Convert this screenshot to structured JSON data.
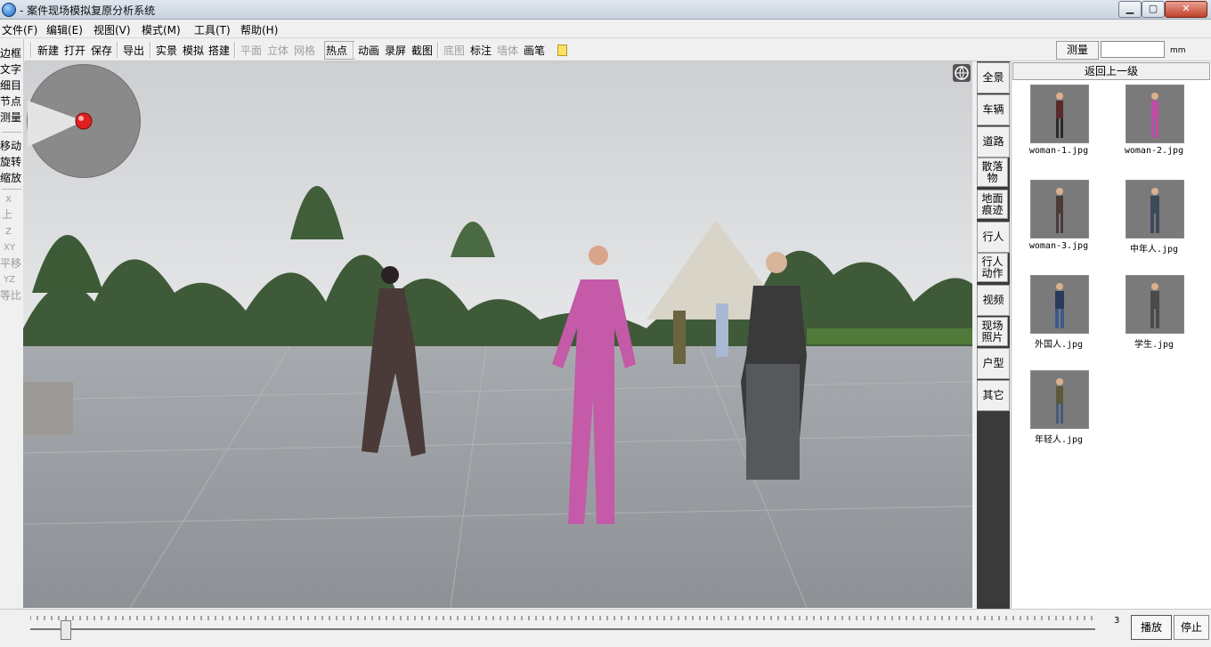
{
  "window": {
    "title": "- 案件现场模拟复原分析系统",
    "minimize": "▁",
    "maximize": "▢",
    "close": "✕"
  },
  "menu": [
    "文件(F)",
    "编辑(E)",
    "视图(V)",
    "模式(M)",
    "工具(T)",
    "帮助(H)"
  ],
  "toolbar": {
    "new": "新建",
    "open": "打开",
    "save": "保存",
    "export": "导出",
    "real": "实景",
    "simulate": "模拟",
    "build": "搭建",
    "plane": "平面",
    "solid": "立体",
    "grid": "网格",
    "hotspot": "热点",
    "animation": "动画",
    "record": "录屏",
    "screenshot": "截图",
    "basemap": "底图",
    "annotate": "标注",
    "wall": "墙体",
    "pen": "画笔",
    "measure": "测量",
    "measure_unit": "mm",
    "measure_value": ""
  },
  "left_tools": [
    "边框",
    "文字",
    "细目",
    "节点",
    "测量",
    "移动",
    "旋转",
    "缩放",
    "X",
    "上",
    "Z",
    "XY",
    "平移",
    "YZ",
    "等比"
  ],
  "categories": [
    "全景",
    "车辆",
    "道路",
    "散落物",
    "地面痕迹",
    "行人",
    "行人动作",
    "视频",
    "现场照片",
    "户型",
    "其它"
  ],
  "thumbnail_panel": {
    "back_label": "返回上一级",
    "items": [
      {
        "label": "woman-1.jpg",
        "color": "#5a2a2a"
      },
      {
        "label": "woman-2.jpg",
        "color": "#c04aa8"
      },
      {
        "label": "woman-3.jpg",
        "color": "#4a3a3a"
      },
      {
        "label": "中年人.jpg",
        "color": "#3c4a5a"
      },
      {
        "label": "外国人.jpg",
        "color": "#2a3a5a"
      },
      {
        "label": "学生.jpg",
        "color": "#4a4a4a"
      },
      {
        "label": "年轻人.jpg",
        "color": "#5a5a3a"
      }
    ]
  },
  "timeline": {
    "frame": "3",
    "play": "播放",
    "stop": "停止"
  },
  "colors": {
    "accent_selected": "#3a3a3a",
    "compass_marker": "#e02020"
  }
}
